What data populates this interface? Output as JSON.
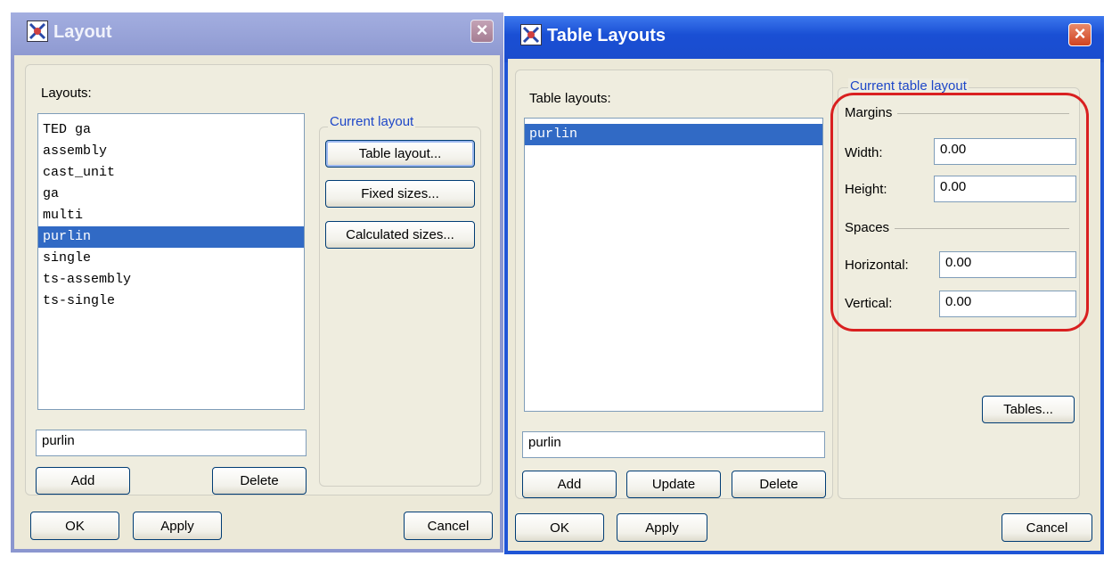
{
  "layout_dialog": {
    "title": "Layout",
    "layouts_label": "Layouts:",
    "layouts": [
      "TED ga",
      "assembly",
      "cast_unit",
      "ga",
      "multi",
      "purlin",
      "single",
      "ts-assembly",
      "ts-single"
    ],
    "selected_index": 5,
    "name_value": "purlin",
    "current_layout_group": "Current layout",
    "table_layout_button": "Table layout...",
    "fixed_sizes_button": "Fixed sizes...",
    "calculated_sizes_button": "Calculated sizes...",
    "add_button": "Add",
    "delete_button": "Delete",
    "ok_button": "OK",
    "apply_button": "Apply",
    "cancel_button": "Cancel"
  },
  "table_layouts_dialog": {
    "title": "Table Layouts",
    "table_layouts_label": "Table layouts:",
    "table_layouts": [
      "purlin"
    ],
    "selected_index": 0,
    "name_value": "purlin",
    "current_table_layout_group": "Current table layout",
    "margins_label": "Margins",
    "width_label": "Width:",
    "width_value": "0.00",
    "height_label": "Height:",
    "height_value": "0.00",
    "spaces_label": "Spaces",
    "horizontal_label": "Horizontal:",
    "horizontal_value": "0.00",
    "vertical_label": "Vertical:",
    "vertical_value": "0.00",
    "tables_button": "Tables...",
    "add_button": "Add",
    "update_button": "Update",
    "delete_button": "Delete",
    "ok_button": "OK",
    "apply_button": "Apply",
    "cancel_button": "Cancel"
  },
  "colors": {
    "active_title": "#1a4fd4",
    "inactive_title": "#8d98d0",
    "selection": "#316ac5",
    "annotation": "#d92020"
  }
}
